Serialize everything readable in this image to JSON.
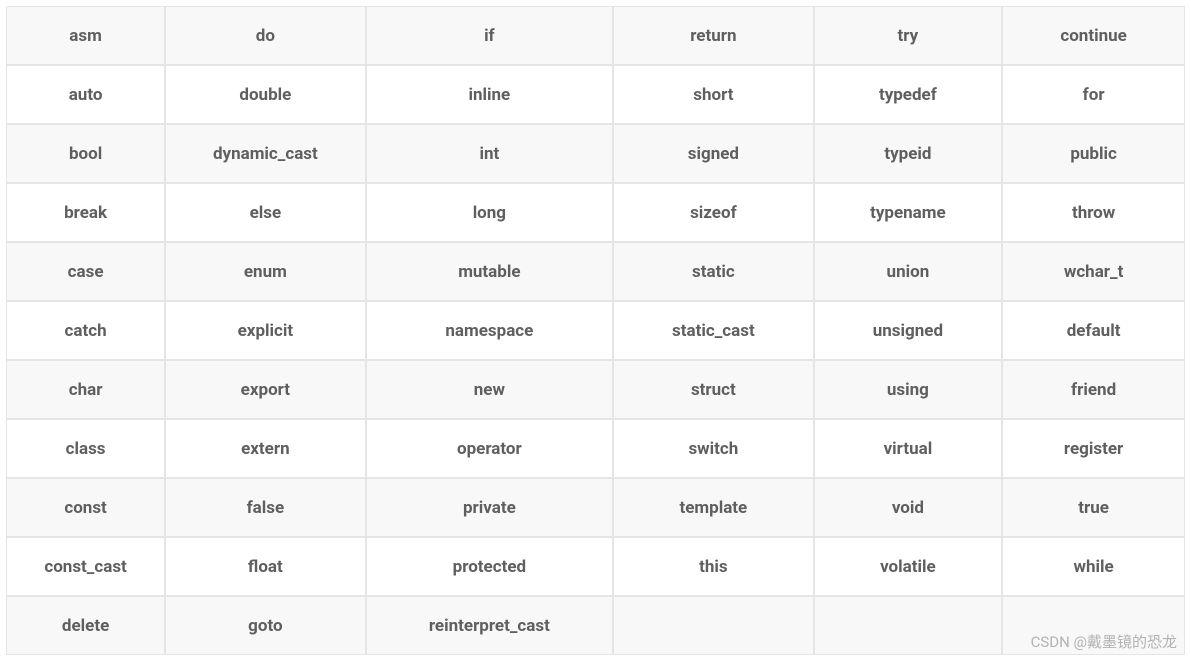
{
  "table": {
    "rows": [
      [
        "asm",
        "do",
        "if",
        "return",
        "try",
        "continue"
      ],
      [
        "auto",
        "double",
        "inline",
        "short",
        "typedef",
        "for"
      ],
      [
        "bool",
        "dynamic_cast",
        "int",
        "signed",
        "typeid",
        "public"
      ],
      [
        "break",
        "else",
        "long",
        "sizeof",
        "typename",
        "throw"
      ],
      [
        "case",
        "enum",
        "mutable",
        "static",
        "union",
        "wchar_t"
      ],
      [
        "catch",
        "explicit",
        "namespace",
        "static_cast",
        "unsigned",
        "default"
      ],
      [
        "char",
        "export",
        "new",
        "struct",
        "using",
        "friend"
      ],
      [
        "class",
        "extern",
        "operator",
        "switch",
        "virtual",
        "register"
      ],
      [
        "const",
        "false",
        "private",
        "template",
        "void",
        "true"
      ],
      [
        "const_cast",
        "float",
        "protected",
        "this",
        "volatile",
        "while"
      ],
      [
        "delete",
        "goto",
        "reinterpret_cast",
        "",
        "",
        ""
      ]
    ]
  },
  "watermark": "CSDN @戴墨镜的恐龙"
}
